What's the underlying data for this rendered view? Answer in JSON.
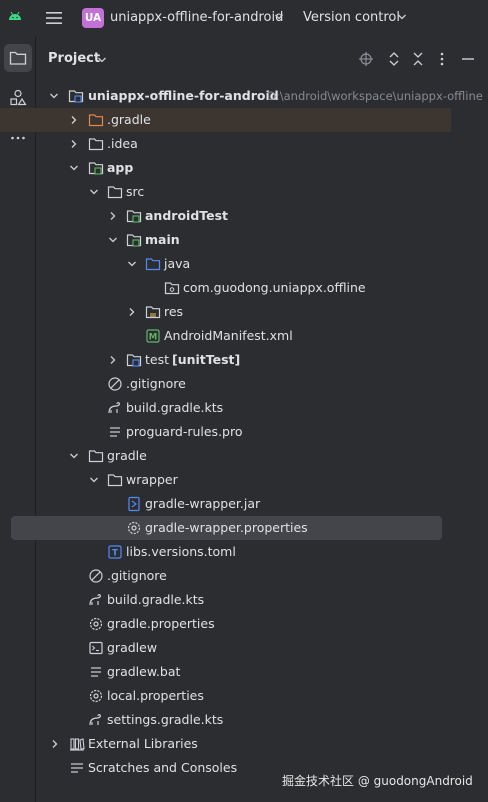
{
  "titlebar": {
    "project_badge": "UA",
    "project_name": "uniappx-offline-for-android",
    "vcs_label": "Version control"
  },
  "panel": {
    "title": "Project"
  },
  "tree": {
    "root": {
      "label": "uniappx-offline-for-android",
      "path": "D:\\android\\workspace\\uniappx-offline"
    },
    "gradle_dir": ".gradle",
    "idea_dir": ".idea",
    "app_dir": "app",
    "src_dir": "src",
    "androidtest_dir": "androidTest",
    "main_dir": "main",
    "java_dir": "java",
    "package": "com.guodong.uniappx.offline",
    "res_dir": "res",
    "manifest": "AndroidManifest.xml",
    "test_dir": "test",
    "test_suffix": "[unitTest]",
    "app_gitignore": ".gitignore",
    "app_build_gradle": "build.gradle.kts",
    "proguard": "proguard-rules.pro",
    "gradle_folder": "gradle",
    "wrapper_dir": "wrapper",
    "wrapper_jar": "gradle-wrapper.jar",
    "wrapper_props": "gradle-wrapper.properties",
    "libs_versions": "libs.versions.toml",
    "root_gitignore": ".gitignore",
    "root_build_gradle": "build.gradle.kts",
    "gradle_properties": "gradle.properties",
    "gradlew": "gradlew",
    "gradlew_bat": "gradlew.bat",
    "local_properties": "local.properties",
    "settings_gradle": "settings.gradle.kts",
    "external_libraries": "External Libraries",
    "scratches": "Scratches and Consoles"
  },
  "watermark": "掘金技术社区 @ guodongAndroid",
  "colors": {
    "background": "#2b2d30",
    "selection": "#43454a",
    "highlight_dir": "#3d3530",
    "folder_icon": "#ced0d6",
    "source_folder": "#548af7",
    "test_folder": "#5fb865",
    "badge": "#c271d6",
    "text": "#dfe1e5",
    "path_text": "#868a91"
  },
  "icons": {
    "titlebar": [
      "android-icon",
      "hamburger-icon",
      "chevron-down-icon"
    ],
    "stripe": [
      "folder-icon",
      "structure-icon",
      "more-icon"
    ],
    "header": [
      "locate-icon",
      "expand-all-icon",
      "collapse-all-icon",
      "options-icon",
      "hide-icon"
    ]
  }
}
